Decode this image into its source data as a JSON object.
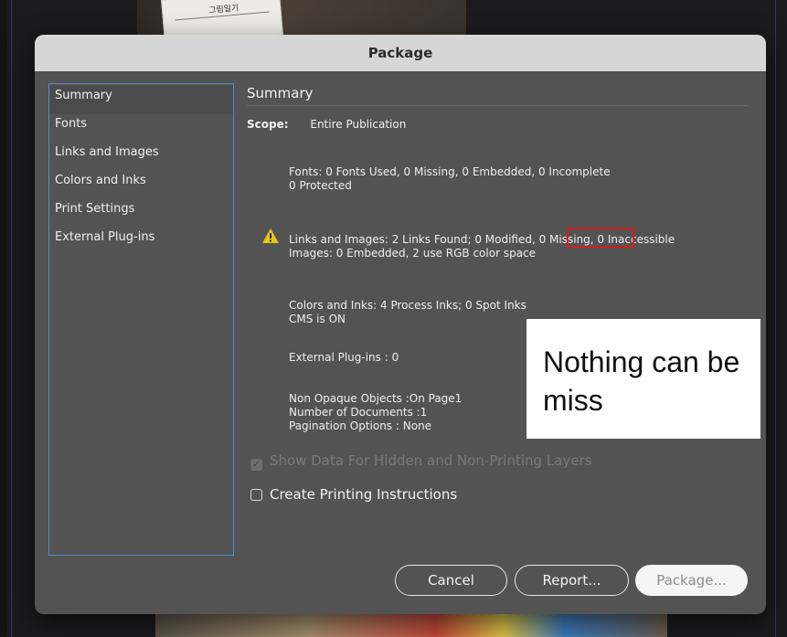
{
  "background": {
    "paper_text": "그림일기"
  },
  "dialog": {
    "title": "Package",
    "sidebar": {
      "items": [
        {
          "label": "Summary",
          "selected": true
        },
        {
          "label": "Fonts"
        },
        {
          "label": "Links and Images"
        },
        {
          "label": "Colors and Inks"
        },
        {
          "label": "Print Settings"
        },
        {
          "label": "External Plug-ins"
        }
      ]
    },
    "summary": {
      "heading": "Summary",
      "scope_label": "Scope:",
      "scope_value": "Entire Publication",
      "fonts_line1": "Fonts: 0 Fonts Used, 0 Missing, 0 Embedded, 0 Incomplete",
      "fonts_line2": "0 Protected",
      "links_line1": "Links and Images: 2 Links Found; 0 Modified, 0 Missing, 0 Inaccessible",
      "links_line2": "Images: 0 Embedded, 2 use RGB color space",
      "colors_line1": "Colors and Inks: 4 Process Inks; 0 Spot Inks",
      "colors_line2": "CMS is ON",
      "plugins_line": "External Plug-ins : 0",
      "misc_line1": "Non Opaque Objects :On Page1",
      "misc_line2": "Number of Documents :1",
      "misc_line3": "Pagination Options : None"
    },
    "options": {
      "show_hidden_label": "Show Data For Hidden and Non-Printing Layers",
      "show_hidden_checked": true,
      "show_hidden_disabled": true,
      "print_instructions_label": "Create Printing Instructions",
      "print_instructions_checked": false
    },
    "buttons": {
      "cancel": "Cancel",
      "report": "Report...",
      "package": "Package..."
    }
  },
  "annotation": {
    "callout_text": "Nothing can be miss",
    "highlight_color": "#d21e1e"
  },
  "colors": {
    "dialog_bg": "#535353",
    "titlebar_bg": "#d6d6d6",
    "sidebar_border": "#5b8bd0",
    "warning": "#e8c51a"
  }
}
